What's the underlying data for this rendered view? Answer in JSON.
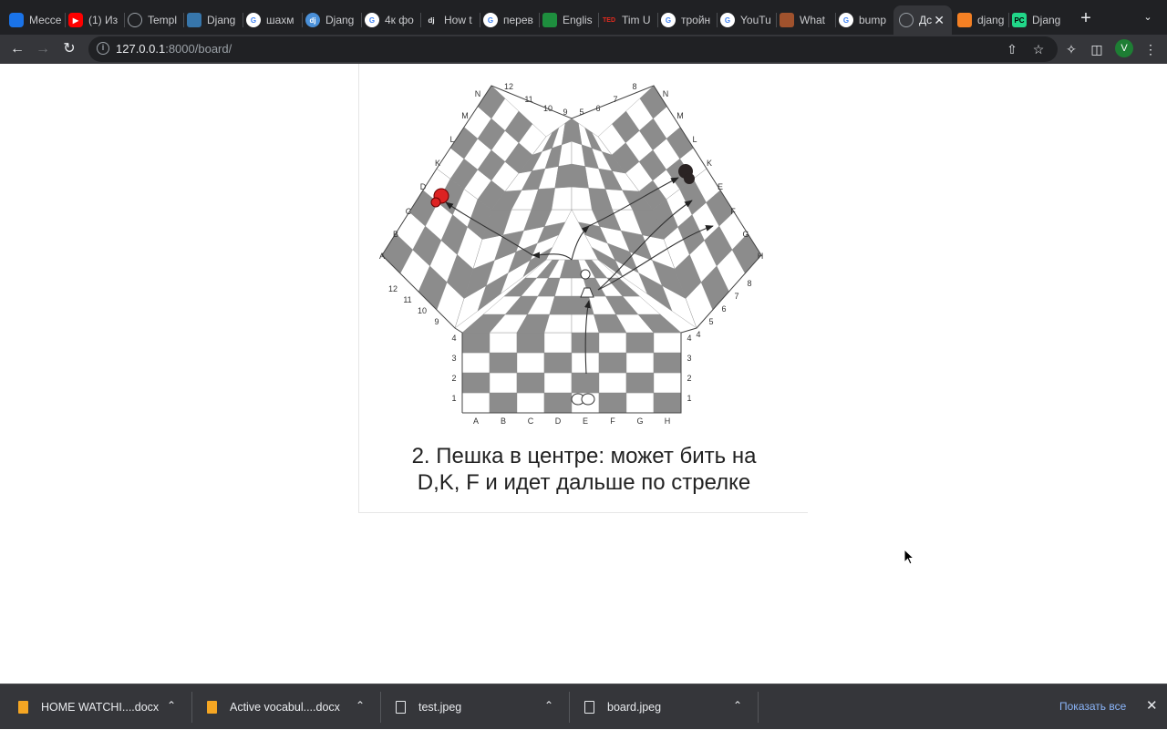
{
  "browser": {
    "tabs": [
      {
        "title": "Мессе",
        "icon": "messenger-icon",
        "color": "#1a73e8"
      },
      {
        "title": "(1) Из",
        "icon": "youtube-icon",
        "color": "#ff0000"
      },
      {
        "title": "Templ",
        "icon": "globe-icon",
        "color": "#9aa0a6"
      },
      {
        "title": "Djang",
        "icon": "python-icon",
        "color": "#3776ab"
      },
      {
        "title": "шахм",
        "icon": "google-icon",
        "color": "#ffffff"
      },
      {
        "title": "Djang",
        "icon": "django-icon",
        "color": "#4a90d9"
      },
      {
        "title": "4к фо",
        "icon": "google-icon",
        "color": "#ffffff"
      },
      {
        "title": "How t",
        "icon": "dj-icon",
        "color": "#0c4b33"
      },
      {
        "title": "перев",
        "icon": "google-icon",
        "color": "#ffffff"
      },
      {
        "title": "Englis",
        "icon": "translate-icon",
        "color": "#1e8e3e"
      },
      {
        "title": "Tim U",
        "icon": "ted-icon",
        "color": "#e62b1e"
      },
      {
        "title": "тройн",
        "icon": "google-icon",
        "color": "#ffffff"
      },
      {
        "title": "YouTu",
        "icon": "google-icon",
        "color": "#ffffff"
      },
      {
        "title": "What",
        "icon": "horse-icon",
        "color": "#a0522d"
      },
      {
        "title": "bump",
        "icon": "google-icon",
        "color": "#ffffff"
      },
      {
        "title": "Дс",
        "icon": "globe-icon",
        "color": "#9aa0a6",
        "active": true
      },
      {
        "title": "djang",
        "icon": "stackoverflow-icon",
        "color": "#f48024"
      },
      {
        "title": "Djang",
        "icon": "pycharm-icon",
        "color": "#21d789"
      }
    ],
    "url_host": "127.0.0.1",
    "url_path": ":8000/board/",
    "profile_initial": "V"
  },
  "page": {
    "caption_line1": "2. Пешка в центре: может бить на",
    "caption_line2": "D,K, F и идет дальше по стрелке"
  },
  "board": {
    "files_bottom": [
      "A",
      "B",
      "C",
      "D",
      "E",
      "F",
      "G",
      "H"
    ],
    "ranks_bottom": [
      "1",
      "2",
      "3",
      "4"
    ],
    "ranks_right_lower": [
      "4",
      "5",
      "6",
      "7",
      "8"
    ],
    "ranks_left_upper": [
      "12",
      "11",
      "10",
      "9"
    ],
    "top_numbers": [
      "12",
      "11",
      "10",
      "9",
      "5",
      "6",
      "7",
      "8"
    ],
    "left_letters": [
      "A",
      "B",
      "C",
      "D",
      "K",
      "L",
      "M",
      "N"
    ],
    "right_letters": [
      "N",
      "M",
      "L",
      "K",
      "E",
      "F",
      "G",
      "H"
    ]
  },
  "downloads": {
    "items": [
      {
        "name": "HOME WATCHI....docx",
        "icon": "docx-icon",
        "color": "#f5a623"
      },
      {
        "name": "Active vocabul....docx",
        "icon": "docx-icon",
        "color": "#f5a623"
      },
      {
        "name": "test.jpeg",
        "icon": "image-file-icon",
        "color": "#e8eaed"
      },
      {
        "name": "board.jpeg",
        "icon": "image-file-icon",
        "color": "#e8eaed"
      }
    ],
    "show_all": "Показать все"
  }
}
